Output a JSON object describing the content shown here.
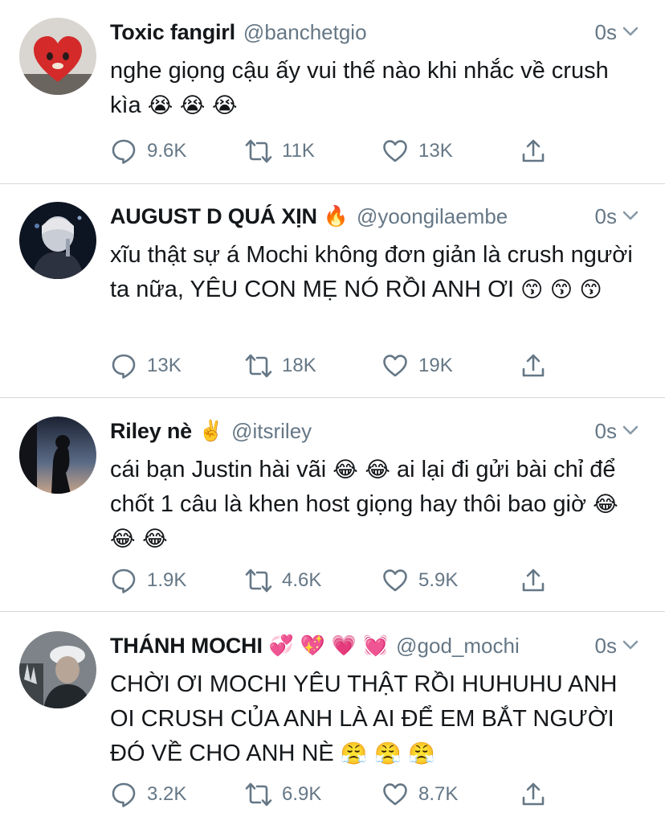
{
  "tweets": [
    {
      "name": "Toxic fangirl",
      "badge": "",
      "handle": "@banchetgio",
      "time": "0s",
      "text": "nghe giọng cậu ấy vui thế nào khi nhắc về crush kìa",
      "emojis": "😭 😭 😭",
      "replies": "9.6K",
      "retweets": "11K",
      "likes": "13K"
    },
    {
      "name": "AUGUST D QUÁ XỊN",
      "badge": "🔥",
      "handle": "@yoongilaembe",
      "time": "0s",
      "text": "xĩu thật sự á Mochi không đơn giản là crush người ta nữa, YÊU CON MẸ NÓ RỒI ANH ƠI",
      "emojis": "😙 😙 😙",
      "replies": "13K",
      "retweets": "18K",
      "likes": "19K"
    },
    {
      "name": "Riley nè",
      "badge": "✌️",
      "handle": "@itsriley",
      "time": "0s",
      "text_a": "cái bạn Justin hài vãi",
      "emojis_a": "😂 😂",
      "text_b": "ai lại đi gửi bài chỉ để chốt 1 câu là khen host giọng hay thôi bao giờ",
      "emojis": "😂 😂 😂",
      "replies": "1.9K",
      "retweets": "4.6K",
      "likes": "5.9K"
    },
    {
      "name": "THÁNH MOCHI",
      "badge": "💞 💖 💗 💓",
      "handle": "@god_mochi",
      "time": "0s",
      "text": "CHỜI ƠI MOCHI YÊU THẬT RỒI HUHUHU ANH OI CRUSH CỦA ANH LÀ AI ĐỂ EM BẮT NGƯỜI ĐÓ VỀ CHO ANH NÈ",
      "emojis": "😤 😤 😤",
      "replies": "3.2K",
      "retweets": "6.9K",
      "likes": "8.7K"
    }
  ],
  "icons": {
    "reply": "reply-icon",
    "retweet": "retweet-icon",
    "like": "heart-icon",
    "share": "share-icon",
    "more": "chevron-down-icon"
  },
  "colors": {
    "text": "#14171a",
    "secondary": "#657786",
    "divider": "#d4d8dc"
  }
}
